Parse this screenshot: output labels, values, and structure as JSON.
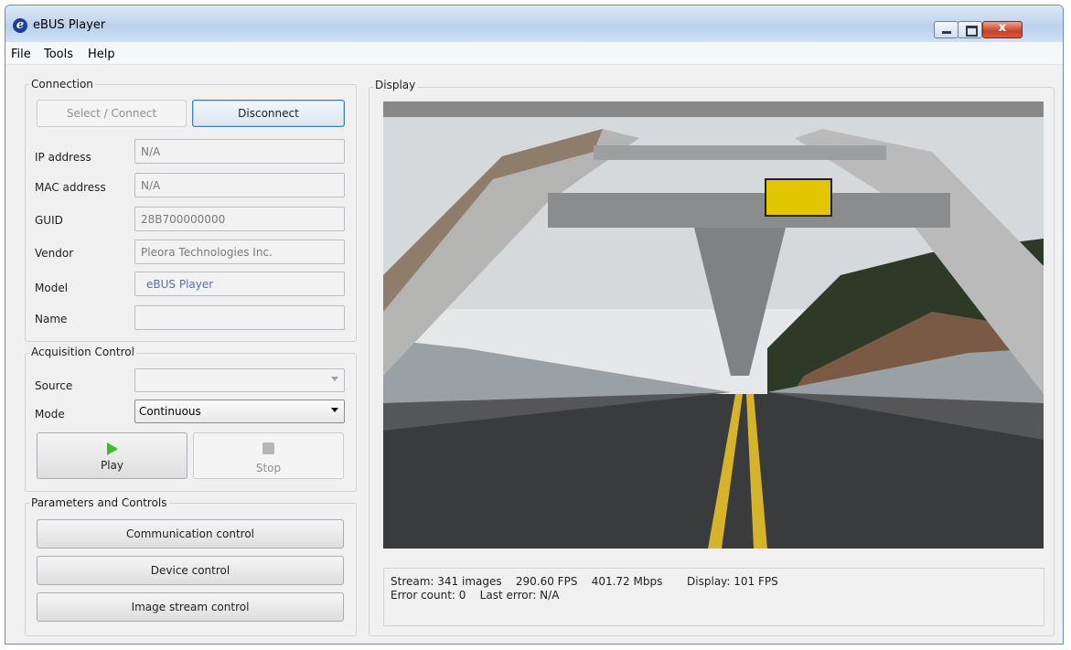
{
  "window": {
    "title": "eBUS Player",
    "app_icon": "e",
    "close_glyph": "x"
  },
  "menu": [
    "File",
    "Tools",
    "Help"
  ],
  "connection": {
    "title": "Connection",
    "select_label": "Select / Connect",
    "disconnect_label": "Disconnect",
    "fields": [
      {
        "label": "IP address",
        "value": "N/A"
      },
      {
        "label": "MAC address",
        "value": "N/A"
      },
      {
        "label": "GUID",
        "value": "28B700000000"
      },
      {
        "label": "Vendor",
        "value": "Pleora Technologies Inc."
      },
      {
        "label": "Model",
        "value": "eBUS Player"
      },
      {
        "label": "Name",
        "value": ""
      }
    ]
  },
  "acquisition": {
    "title": "Acquisition Control",
    "source_label": "Source",
    "source_value": "",
    "mode_label": "Mode",
    "mode_value": "Continuous",
    "play_label": "Play",
    "stop_label": "Stop"
  },
  "parameters": {
    "title": "Parameters and Controls",
    "buttons": [
      "Communication control",
      "Device control",
      "Image stream control"
    ]
  },
  "display": {
    "title": "Display",
    "status_line1": "Stream: 341 images    290.60 FPS    401.72 Mbps       Display: 101 FPS",
    "status_line2": "Error count: 0    Last error: N/A"
  },
  "colors": {
    "play_icon": "#3bbf29",
    "title_bar": "#c3d7ef",
    "focus_border": "#3c7fb1",
    "close_button": "#c7412a"
  }
}
